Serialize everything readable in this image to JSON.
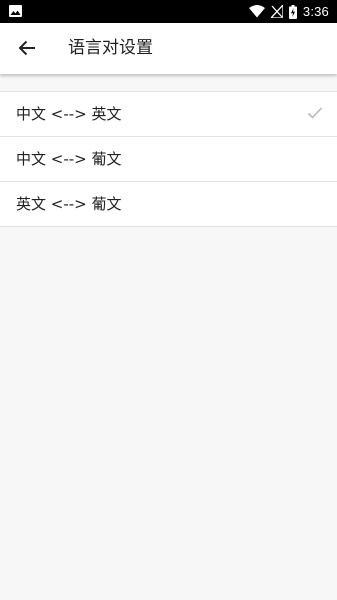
{
  "status_bar": {
    "time": "3:36",
    "icons": [
      "image-icon",
      "wifi-icon",
      "no-signal-icon",
      "battery-charging-icon"
    ]
  },
  "header": {
    "back_icon": "arrow-left-icon",
    "title": "语言对设置"
  },
  "language_pairs": [
    {
      "label": "中文 <--> 英文",
      "selected": true
    },
    {
      "label": "中文 <--> 葡文",
      "selected": false
    },
    {
      "label": "英文 <--> 葡文",
      "selected": false
    }
  ],
  "colors": {
    "status_bar": "#000000",
    "app_bar": "#ffffff",
    "background": "#f7f7f7",
    "check": "#b8b8b8"
  }
}
